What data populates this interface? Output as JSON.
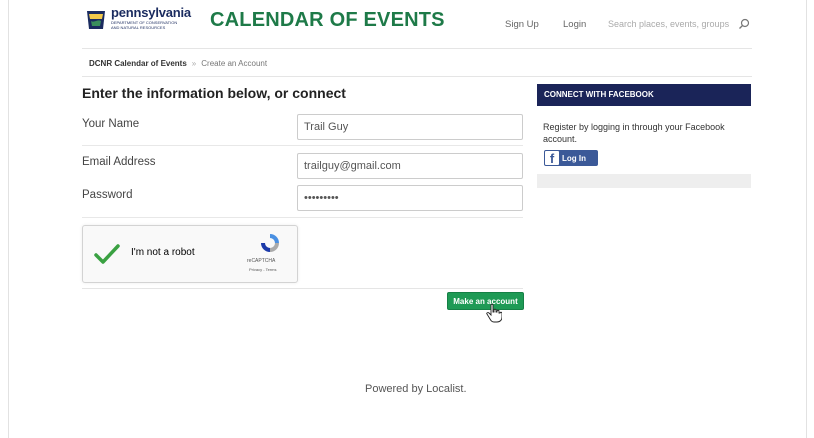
{
  "header": {
    "logo_name": "pennsylvania",
    "logo_subtitle": "DEPARTMENT OF CONSERVATION AND NATURAL RESOURCES",
    "site_title": "CALENDAR OF EVENTS",
    "signup_label": "Sign Up",
    "login_label": "Login",
    "search_placeholder": "Search places, events, groups",
    "search_icon": "search-icon",
    "brand_color": "#1e7a48"
  },
  "breadcrumb": {
    "home": "DCNR Calendar of Events",
    "current": "Create an Account"
  },
  "form": {
    "heading": "Enter the information below, or connect",
    "name_label": "Your Name",
    "name_value": "Trail Guy",
    "email_label": "Email Address",
    "email_value": "trailguy@gmail.com",
    "password_label": "Password",
    "password_value": "•••••••••",
    "submit_label": "Make an account",
    "submit_color": "#1e9a55"
  },
  "captcha": {
    "label": "I'm not a robot",
    "brand": "reCAPTCHA",
    "terms": "Privacy - Terms",
    "checked": true
  },
  "facebook": {
    "header": "CONNECT WITH FACEBOOK",
    "text": "Register by logging in through your Facebook account.",
    "login_label": "Log In",
    "header_color": "#1a2458",
    "button_color": "#3b5998"
  },
  "footer": {
    "powered": "Powered by Localist."
  }
}
